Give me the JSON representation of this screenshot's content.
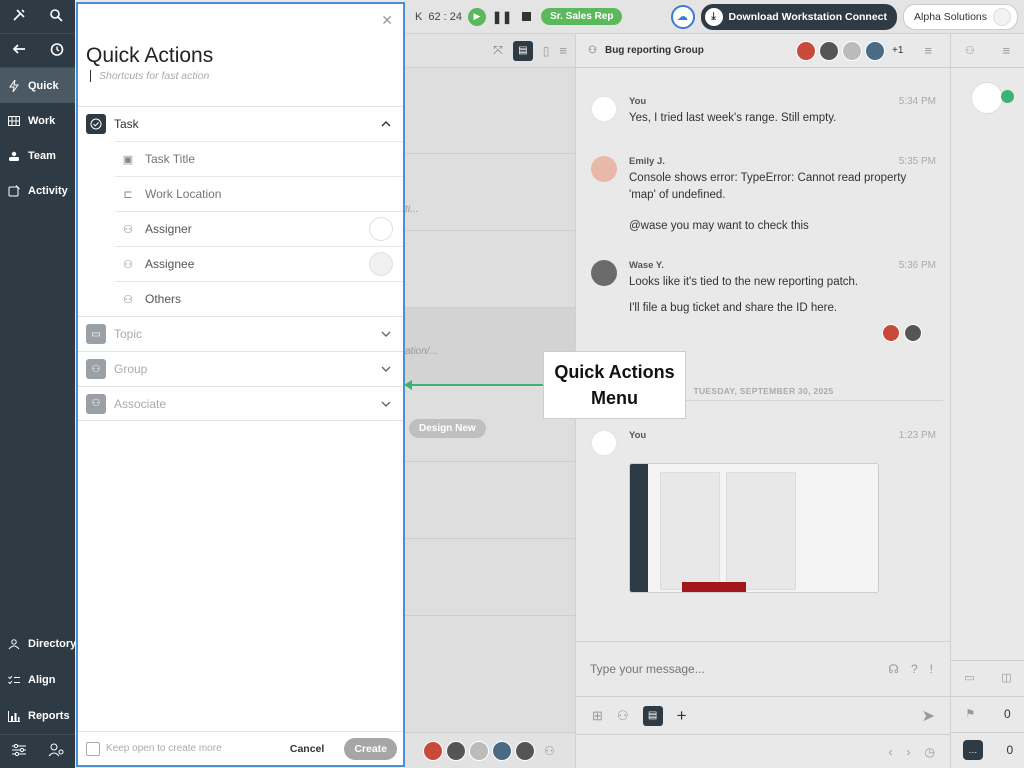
{
  "leftnav": {
    "items": [
      {
        "label": "Quick",
        "icon": "bolt-icon"
      },
      {
        "label": "Work",
        "icon": "grid-icon"
      },
      {
        "label": "Team",
        "icon": "team-icon"
      },
      {
        "label": "Activity",
        "icon": "activity-icon"
      }
    ],
    "bottom_items": [
      {
        "label": "Directory",
        "icon": "directory-icon"
      },
      {
        "label": "Align",
        "icon": "checklist-icon"
      },
      {
        "label": "Reports",
        "icon": "chart-icon"
      }
    ]
  },
  "topbar": {
    "timer_prefix": "K",
    "timer": "62 : 24",
    "role": "Sr. Sales Rep",
    "download_label": "Download Workstation Connect",
    "org_name": "Alpha Solutions"
  },
  "middle": {
    "snippet1": "ti...",
    "snippet2": "ation/...",
    "pill": "Design New"
  },
  "chat": {
    "group_name": "Bug reporting Group",
    "more_count": "+1",
    "messages": [
      {
        "name": "You",
        "time": "5:34 PM",
        "text": "Yes, I tried last week's range. Still empty."
      },
      {
        "name": "Emily J.",
        "time": "5:35 PM",
        "text": "Console shows error: TypeError: Cannot read property 'map' of undefined.",
        "text2": "@wase you may want to check this"
      },
      {
        "name": "Wase Y.",
        "time": "5:36 PM",
        "text": "Looks like it's tied to the new reporting patch.",
        "text2": "I'll file a bug ticket and share the ID here."
      },
      {
        "name": "You",
        "time": "1:23 PM"
      }
    ],
    "date_separator": "TUESDAY, SEPTEMBER 30, 2025",
    "composer_placeholder": "Type your message..."
  },
  "rail": {
    "flag_count": "0",
    "chat_count": "0"
  },
  "quick_actions": {
    "title": "Quick Actions",
    "subtitle": "Shortcuts for fast action",
    "sections": {
      "task": "Task",
      "topic": "Topic",
      "group": "Group",
      "associate": "Associate"
    },
    "fields": {
      "task_title_placeholder": "Task Title",
      "work_location_placeholder": "Work Location",
      "assigner": "Assigner",
      "assignee": "Assignee",
      "others": "Others"
    },
    "footer": {
      "keep_open": "Keep open to create more",
      "cancel": "Cancel",
      "create": "Create"
    }
  },
  "annotation": {
    "line1": "Quick Actions",
    "line2": "Menu",
    "arrow_color": "#3cb371"
  },
  "colors": {
    "nav_bg": "#2f3b44",
    "accent_green": "#5cb85c",
    "panel_border": "#4a90d9"
  }
}
